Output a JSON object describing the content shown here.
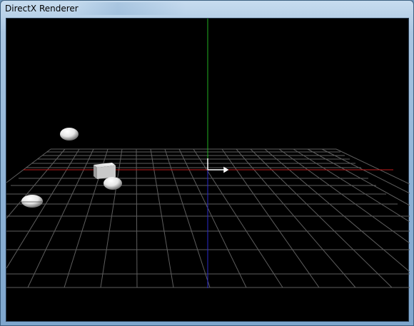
{
  "window": {
    "title": "DirectX Renderer"
  },
  "scene": {
    "background": "#000000",
    "grid_color": "#6a6a6a",
    "x_axis_color": "#c81e1e",
    "y_axis_color": "#1fb41f",
    "z_axis_color": "#2a2acc",
    "objects": [
      {
        "name": "sphere",
        "color": "#f2f2f2"
      },
      {
        "name": "cube",
        "color": "#d8d8d8"
      },
      {
        "name": "sphere",
        "color": "#f2f2f2"
      },
      {
        "name": "sphere",
        "color": "#f2f2f2"
      }
    ]
  }
}
